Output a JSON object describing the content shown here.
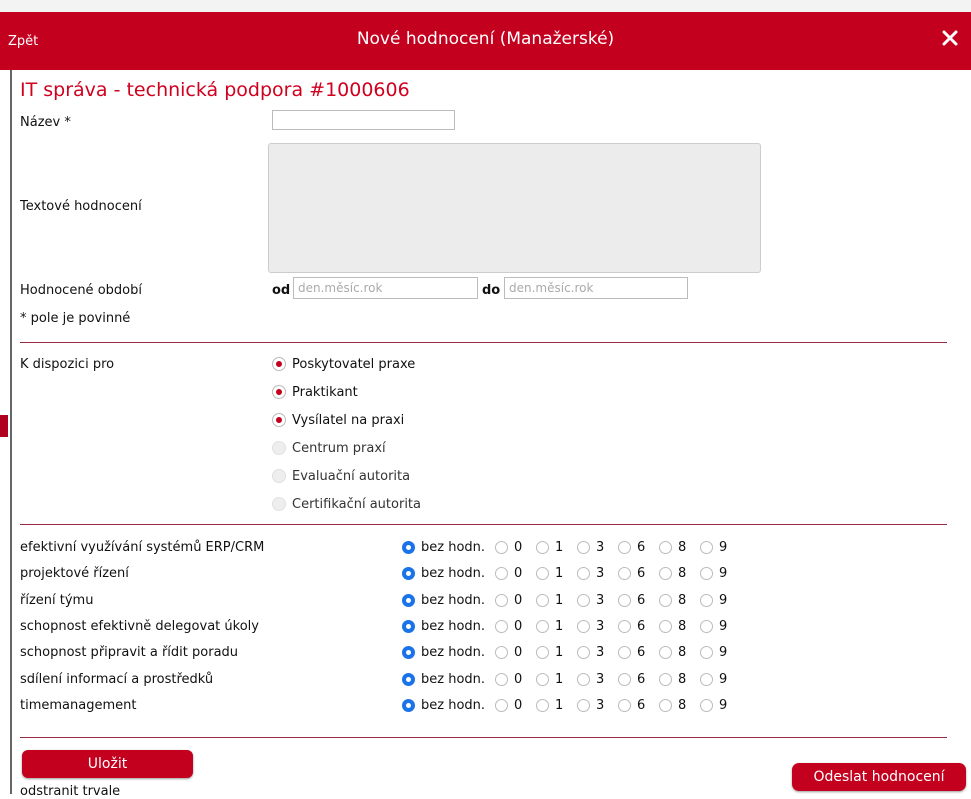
{
  "header": {
    "back_label": "Zpět",
    "title": "Nové hodnocení (Manažerské)",
    "close_icon": "close-icon"
  },
  "project": {
    "title": "IT správa - technická podpora #1000606"
  },
  "form": {
    "name_label": "Název *",
    "name_value": "",
    "text_label": "Textové hodnocení",
    "text_value": "",
    "period_label": "Hodnocené období",
    "from_label": "od",
    "from_placeholder": "den.měsíc.rok",
    "to_label": "do",
    "to_placeholder": "den.měsíc.rok",
    "required_note": "* pole je povinné"
  },
  "availability": {
    "label": "K dispozici pro",
    "options": [
      {
        "label": "Poskytovatel praxe",
        "checked": true,
        "disabled": false
      },
      {
        "label": "Praktikant",
        "checked": true,
        "disabled": false
      },
      {
        "label": "Vysílatel na praxi",
        "checked": true,
        "disabled": false
      },
      {
        "label": "Centrum praxí",
        "checked": false,
        "disabled": true
      },
      {
        "label": "Evaluační autorita",
        "checked": false,
        "disabled": true
      },
      {
        "label": "Certifikační autorita",
        "checked": false,
        "disabled": true
      }
    ]
  },
  "criteria": {
    "scale": [
      "bez hodn.",
      "0",
      "1",
      "3",
      "6",
      "8",
      "9"
    ],
    "selected": "bez hodn.",
    "items": [
      "efektivní využívání systémů ERP/CRM",
      "projektové řízení",
      "řízení týmu",
      "schopnost efektivně delegovat úkoly",
      "schopnost připravit a řídit poradu",
      "sdílení informací a prostředků",
      "timemanagement"
    ]
  },
  "actions": {
    "save_label": "Uložit",
    "remove_label": "odstranit trvale",
    "submit_label": "Odeslat hodnocení"
  },
  "colors": {
    "brand": "#c3001e",
    "accent_radio": "#1a73e8",
    "title_red": "#d0001f"
  }
}
